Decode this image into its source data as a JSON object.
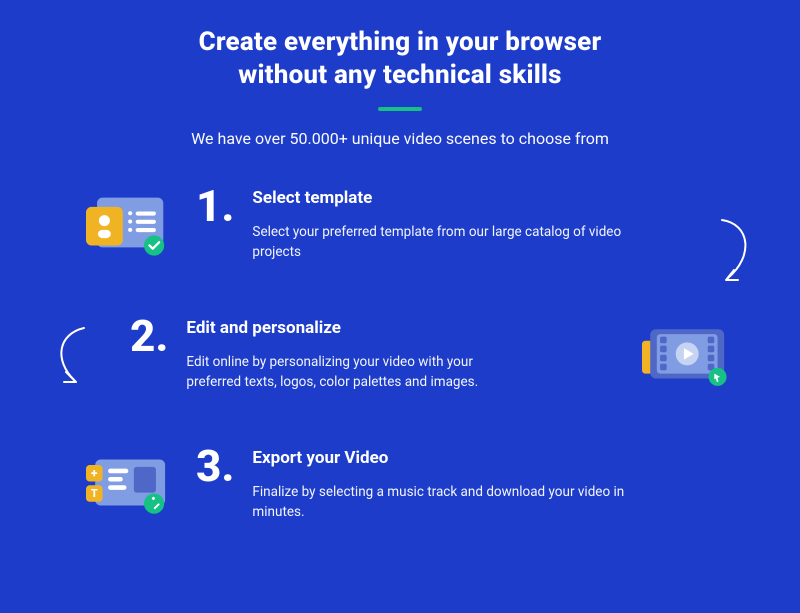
{
  "hero": {
    "title": "Create everything in your browser\nwithout any technical skills",
    "subtitle": "We have over 50.000+ unique video scenes to choose from"
  },
  "steps": [
    {
      "number": "1.",
      "title": "Select template",
      "desc": "Select your preferred template from our large catalog of video projects"
    },
    {
      "number": "2.",
      "title": "Edit and personalize",
      "desc": "Edit online by personalizing your video with your preferred texts, logos, color palettes and images."
    },
    {
      "number": "3.",
      "title": "Export your Video",
      "desc": "Finalize by selecting a music track and download your video in minutes."
    }
  ],
  "colors": {
    "bg": "#1c3cc9",
    "accent_green": "#17c084",
    "accent_yellow": "#f0b323",
    "card_blue": "#809de4",
    "card_blue_dark": "#4f67c7"
  }
}
